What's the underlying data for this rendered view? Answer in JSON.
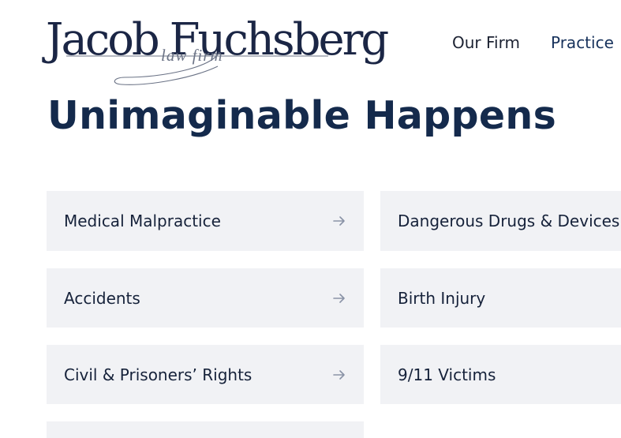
{
  "logo": {
    "name": "Jacob Fuchsberg",
    "tagline": "law firm"
  },
  "nav": {
    "items": [
      {
        "label": "Our Firm"
      },
      {
        "label": "Practice"
      }
    ]
  },
  "headline": "Unimaginable Happens",
  "practice_areas": [
    {
      "label": "Medical Malpractice"
    },
    {
      "label": "Dangerous Drugs & Devices"
    },
    {
      "label": "Accidents"
    },
    {
      "label": "Birth Injury"
    },
    {
      "label": "Civil & Prisoners’ Rights"
    },
    {
      "label": "9/11 Victims"
    }
  ],
  "colors": {
    "brand_navy": "#142a4c",
    "card_bg": "#f1f2f5",
    "arrow": "#8a93a6"
  },
  "icons": {
    "card_arrow": "arrow-right-icon"
  }
}
